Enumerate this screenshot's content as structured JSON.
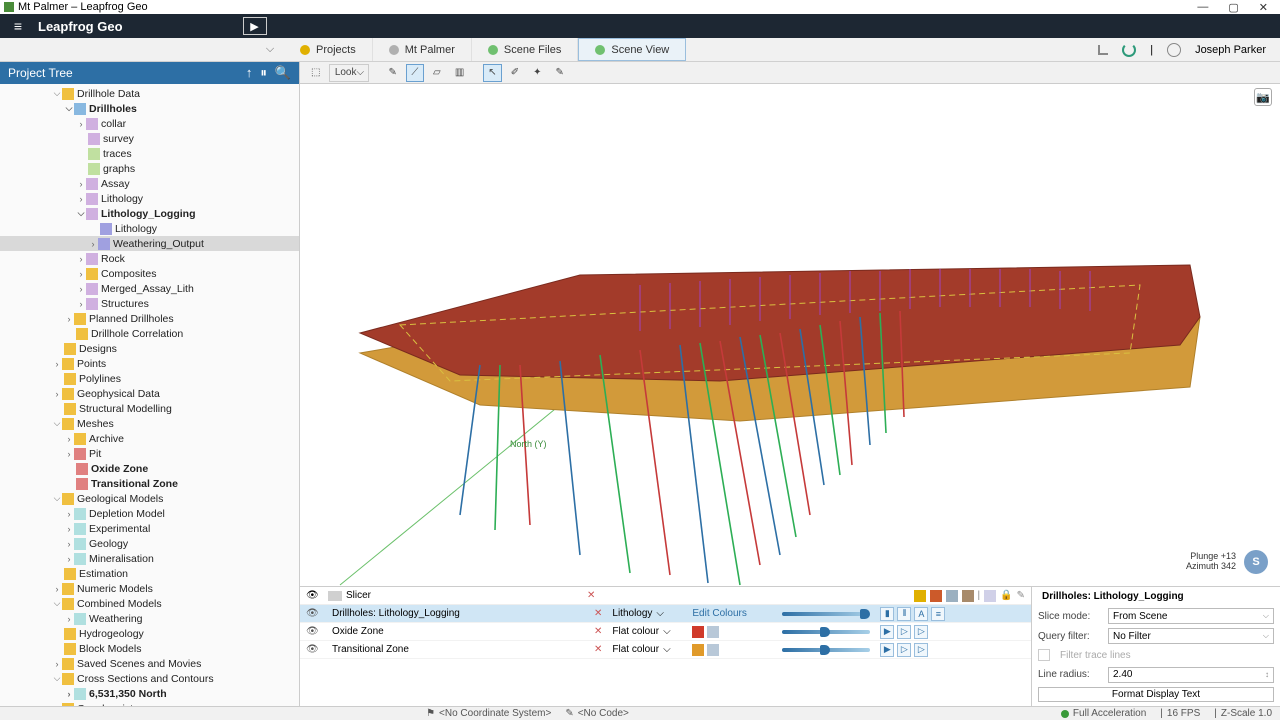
{
  "window": {
    "title": "Mt Palmer – Leapfrog Geo",
    "app_name": "Leapfrog Geo"
  },
  "nav_tabs": {
    "projects": "Projects",
    "context": "Mt Palmer",
    "scene_files": "Scene Files",
    "scene_view": "Scene View"
  },
  "user": {
    "name": "Joseph Parker"
  },
  "tree": {
    "title": "Project Tree",
    "items": {
      "drillhole_data": "Drillhole Data",
      "drillholes": "Drillholes",
      "collar": "collar",
      "survey": "survey",
      "traces": "traces",
      "graphs": "graphs",
      "assay": "Assay",
      "lithology": "Lithology",
      "lithology_logging": "Lithology_Logging",
      "lithology2": "Lithology",
      "weathering_output": "Weathering_Output",
      "rock": "Rock",
      "composites": "Composites",
      "merged_assay_lith": "Merged_Assay_Lith",
      "structures": "Structures",
      "planned_drillholes": "Planned Drillholes",
      "drillhole_correlation": "Drillhole Correlation",
      "designs": "Designs",
      "points": "Points",
      "polylines": "Polylines",
      "geophysical_data": "Geophysical Data",
      "structural_modelling": "Structural Modelling",
      "meshes": "Meshes",
      "archive": "Archive",
      "pit": "Pit",
      "oxide_zone": "Oxide Zone",
      "transitional_zone": "Transitional Zone",
      "geological_models": "Geological Models",
      "depletion_model": "Depletion Model",
      "experimental": "Experimental",
      "geology": "Geology",
      "mineralisation": "Mineralisation",
      "estimation": "Estimation",
      "numeric_models": "Numeric Models",
      "combined_models": "Combined Models",
      "weathering": "Weathering",
      "hydrogeology": "Hydrogeology",
      "block_models": "Block Models",
      "saved_scenes": "Saved Scenes and Movies",
      "cross_sections": "Cross Sections and Contours",
      "cs_north": "6,531,350 North",
      "geochemistry": "Geochemistry"
    }
  },
  "scene_toolbar": {
    "look": "Look"
  },
  "viewport": {
    "north_label": "North (Y)",
    "plunge": "Plunge +13",
    "azimuth": "Azimuth 342"
  },
  "scene_list": {
    "slicer": "Slicer",
    "rows": {
      "r0": {
        "name": "Drillholes: Lithology_Logging",
        "col": "Lithology",
        "edit": "Edit Colours"
      },
      "r1": {
        "name": "Oxide Zone",
        "col": "Flat colour"
      },
      "r2": {
        "name": "Transitional Zone",
        "col": "Flat colour"
      }
    }
  },
  "props": {
    "title": "Drillholes: Lithology_Logging",
    "slice_mode_label": "Slice mode:",
    "slice_mode_value": "From Scene",
    "query_filter_label": "Query filter:",
    "query_filter_value": "No Filter",
    "filter_trace_lines": "Filter trace lines",
    "line_radius_label": "Line radius:",
    "line_radius_value": "2.40",
    "format_display_text": "Format Display Text"
  },
  "status": {
    "coord": "<No Coordinate System>",
    "code": "<No Code>",
    "accel": "Full Acceleration",
    "fps": "16 FPS",
    "zscale": "Z-Scale 1.0"
  }
}
